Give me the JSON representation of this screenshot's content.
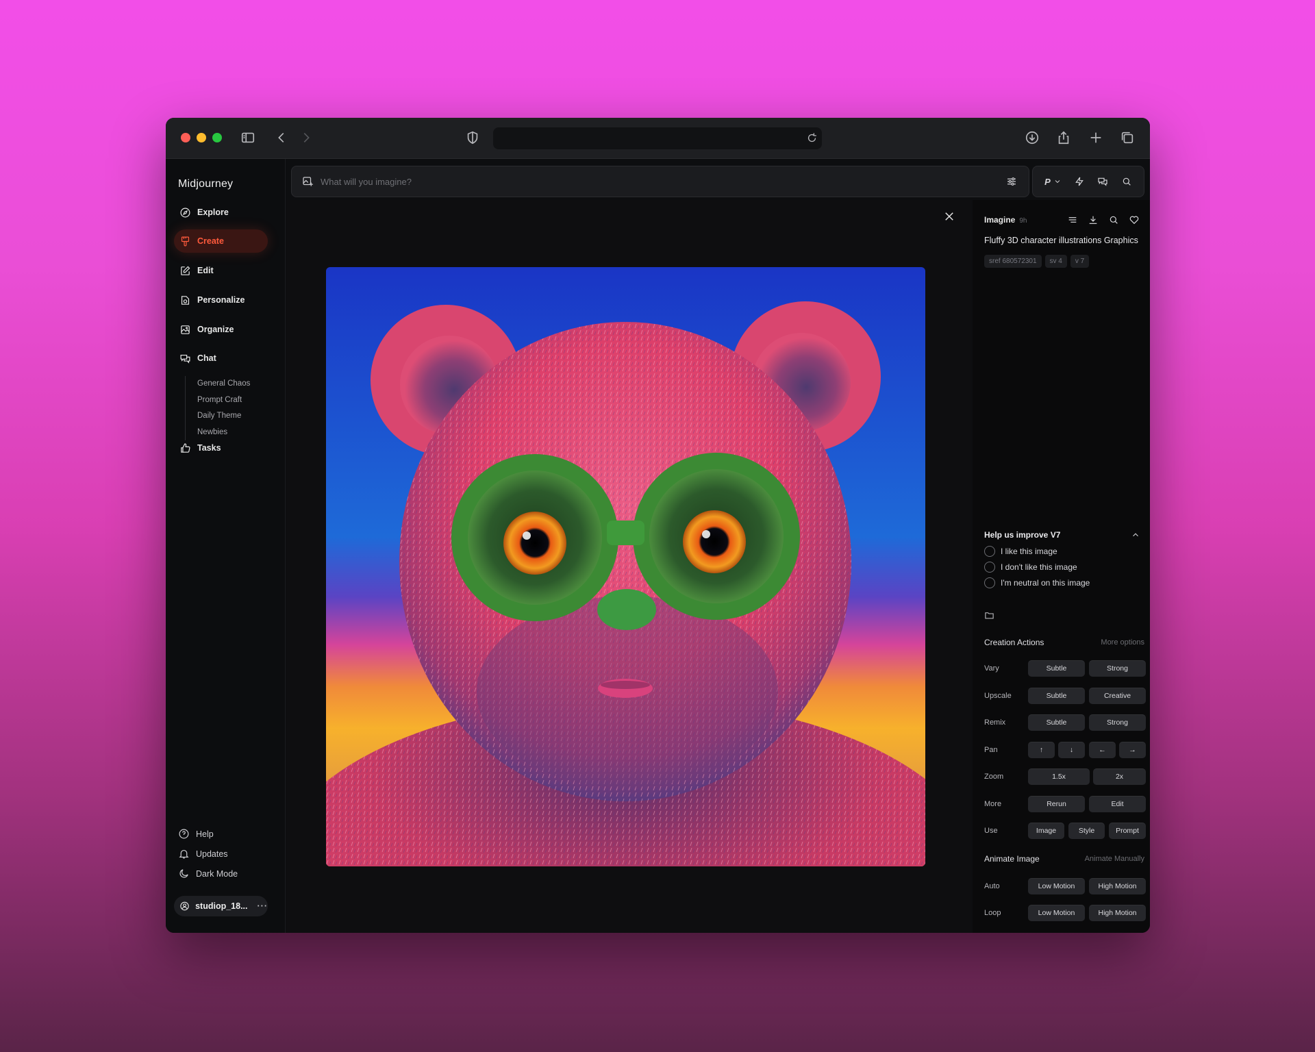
{
  "app": {
    "brand": "Midjourney",
    "url": ""
  },
  "sidebar": {
    "items": [
      {
        "label": "Explore",
        "icon": "compass-icon"
      },
      {
        "label": "Create",
        "icon": "brush-icon",
        "active": true
      },
      {
        "label": "Edit",
        "icon": "edit-icon"
      },
      {
        "label": "Personalize",
        "icon": "personalize-icon"
      },
      {
        "label": "Organize",
        "icon": "image-icon"
      },
      {
        "label": "Chat",
        "icon": "chat-icon"
      }
    ],
    "chat_rooms": [
      "General Chaos",
      "Prompt Craft",
      "Daily Theme",
      "Newbies"
    ],
    "tasks": {
      "label": "Tasks",
      "icon": "thumbs-up-icon"
    },
    "footer": [
      {
        "label": "Help",
        "icon": "help-icon"
      },
      {
        "label": "Updates",
        "icon": "bell-icon"
      },
      {
        "label": "Dark Mode",
        "icon": "moon-icon"
      }
    ],
    "user": {
      "name": "studiop_18...",
      "menu": "···"
    }
  },
  "prompt": {
    "placeholder": "What will you imagine?",
    "mode_label": "P"
  },
  "panel": {
    "job_type": "Imagine",
    "age": "9h",
    "title": "Fluffy 3D character illustrations Graphics",
    "tags": [
      "sref 680572301",
      "sv 4",
      "v 7"
    ],
    "survey": {
      "title": "Help us improve V7",
      "options": [
        "I like this image",
        "I don't like this image",
        "I'm neutral on this image"
      ]
    },
    "creation": {
      "title": "Creation Actions",
      "more": "More options",
      "rows": {
        "vary": {
          "label": "Vary",
          "buttons": [
            "Subtle",
            "Strong"
          ]
        },
        "upscale": {
          "label": "Upscale",
          "buttons": [
            "Subtle",
            "Creative"
          ]
        },
        "remix": {
          "label": "Remix",
          "buttons": [
            "Subtle",
            "Strong"
          ]
        },
        "pan": {
          "label": "Pan",
          "buttons": [
            "↑",
            "↓",
            "←",
            "→"
          ]
        },
        "zoom": {
          "label": "Zoom",
          "buttons": [
            "1.5x",
            "2x"
          ]
        },
        "more": {
          "label": "More",
          "buttons": [
            "Rerun",
            "Edit"
          ]
        },
        "use": {
          "label": "Use",
          "buttons": [
            "Image",
            "Style",
            "Prompt"
          ]
        }
      }
    },
    "animate": {
      "title": "Animate Image",
      "manual": "Animate Manually",
      "rows": {
        "auto": {
          "label": "Auto",
          "buttons": [
            "Low Motion",
            "High Motion"
          ]
        },
        "loop": {
          "label": "Loop",
          "buttons": [
            "Low Motion",
            "High Motion"
          ]
        }
      }
    }
  },
  "colors": {
    "accent": "#ff5a3c",
    "bear_pink": "#e2496b",
    "glasses_green": "#3f9a3b",
    "sky_blue": "#2453c9"
  }
}
